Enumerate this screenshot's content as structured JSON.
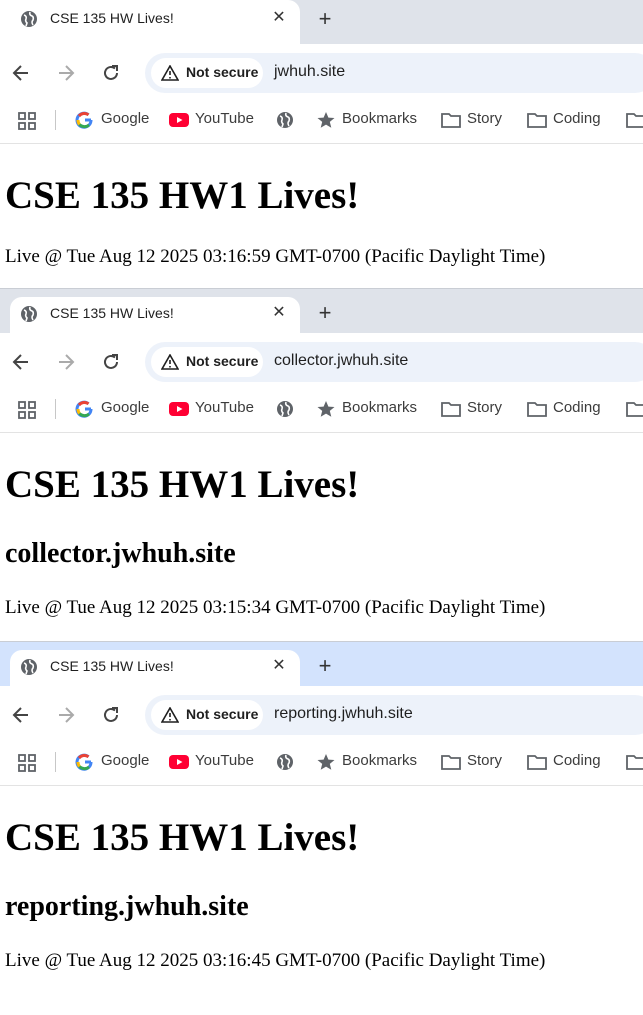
{
  "windows": [
    {
      "tab": {
        "title": "CSE 135 HW Lives!",
        "close": "✕"
      },
      "new_tab": "+",
      "security": "Not secure",
      "url": "jwhuh.site",
      "bookmarks": {
        "google": "Google",
        "youtube": "YouTube",
        "bookmarks": "Bookmarks",
        "story": "Story",
        "coding": "Coding"
      },
      "page": {
        "h1": "CSE 135 HW1 Lives!",
        "live": "Live @ Tue Aug 12 2025 03:16:59 GMT-0700 (Pacific Daylight Time)"
      }
    },
    {
      "tab": {
        "title": "CSE 135 HW Lives!",
        "close": "✕"
      },
      "new_tab": "+",
      "security": "Not secure",
      "url": "collector.jwhuh.site",
      "bookmarks": {
        "google": "Google",
        "youtube": "YouTube",
        "bookmarks": "Bookmarks",
        "story": "Story",
        "coding": "Coding"
      },
      "page": {
        "h1": "CSE 135 HW1 Lives!",
        "h2": "collector.jwhuh.site",
        "live": "Live @ Tue Aug 12 2025 03:15:34 GMT-0700 (Pacific Daylight Time)"
      }
    },
    {
      "tab": {
        "title": "CSE 135 HW Lives!",
        "close": "✕"
      },
      "new_tab": "+",
      "security": "Not secure",
      "url": "reporting.jwhuh.site",
      "bookmarks": {
        "google": "Google",
        "youtube": "YouTube",
        "bookmarks": "Bookmarks",
        "story": "Story",
        "coding": "Coding"
      },
      "page": {
        "h1": "CSE 135 HW1 Lives!",
        "h2": "reporting.jwhuh.site",
        "live": "Live @ Tue Aug 12 2025 03:16:45 GMT-0700 (Pacific Daylight Time)"
      }
    }
  ],
  "colors": {
    "tabstrip_inactive": "#dfe3ea",
    "tabstrip_active": "#d3e3fd",
    "omnibox_bg": "#edf2fa",
    "youtube_red": "#ff0033"
  },
  "icons": [
    "globe-icon",
    "close-icon",
    "plus-icon",
    "back-arrow-icon",
    "forward-arrow-icon",
    "reload-icon",
    "warning-icon",
    "apps-grid-icon",
    "google-icon",
    "youtube-icon",
    "star-icon",
    "folder-icon"
  ]
}
